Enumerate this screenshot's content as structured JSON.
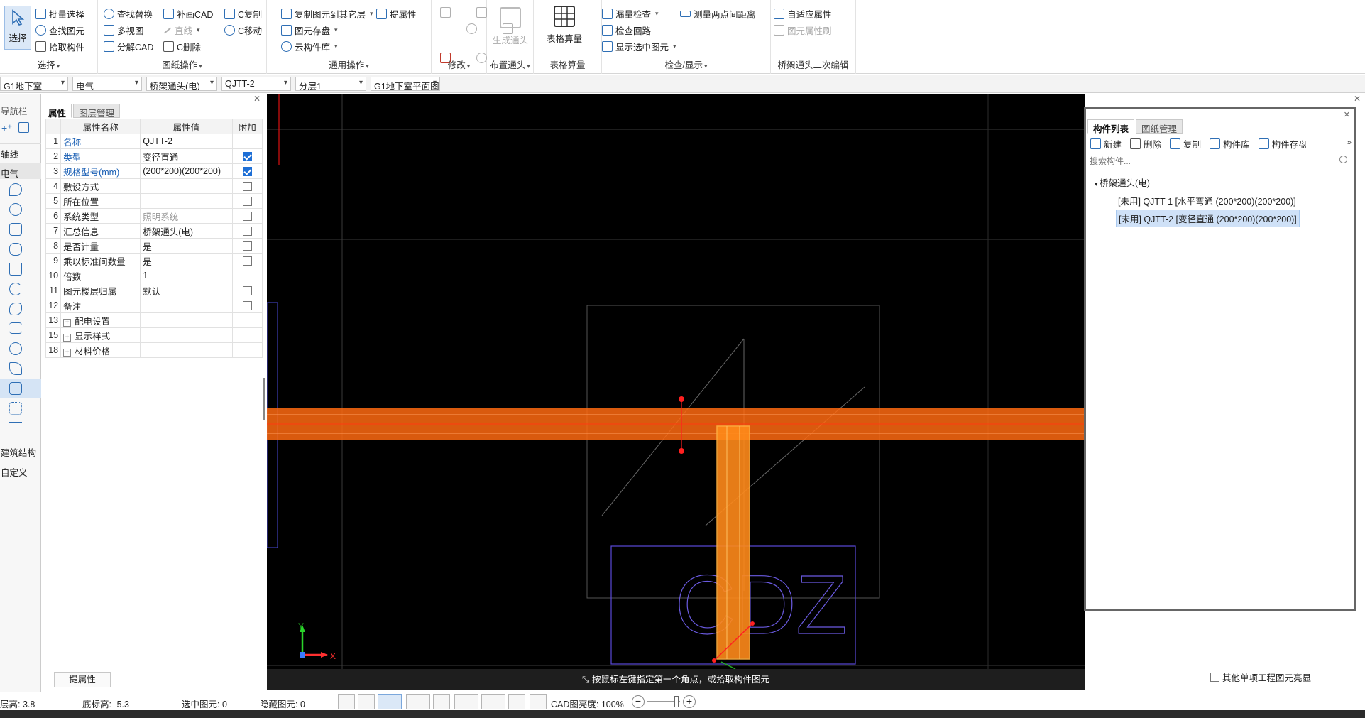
{
  "ribbon": {
    "select_label": "选择",
    "groups": {
      "select": {
        "label": "选择",
        "items": [
          "批量选择",
          "查找图元",
          "拾取构件"
        ]
      },
      "drawing": {
        "label": "图纸操作",
        "items": [
          "查找替换",
          "多视图",
          "分解CAD",
          "补画CAD",
          "直线",
          "C删除",
          "C复制",
          "C移动"
        ]
      },
      "general": {
        "label": "通用操作",
        "items": [
          "复制图元到其它层",
          "图元存盘",
          "云构件库",
          "提属性"
        ]
      },
      "modify": {
        "label": "修改"
      },
      "layout": {
        "label": "布置通头",
        "items": [
          "生成通头"
        ]
      },
      "table": {
        "label": "表格算量",
        "items": [
          "表格算量"
        ]
      },
      "check": {
        "label": "检查/显示",
        "items": [
          "漏量检查",
          "检查回路",
          "显示选中图元",
          "测量两点间距离"
        ]
      },
      "edit": {
        "label": "桥架通头二次编辑",
        "items": [
          "自适应属性",
          "图元属性刷"
        ]
      }
    }
  },
  "selectors": [
    "G1地下室",
    "电气",
    "桥架通头(电)",
    "QJTT-2",
    "分层1",
    "G1地下室平面图"
  ],
  "nav": {
    "title": "导航栏",
    "items": [
      "轴线",
      "电气",
      "建筑结构",
      "自定义"
    ]
  },
  "props": {
    "tabs": [
      "属性",
      "图层管理"
    ],
    "headers": [
      "属性名称",
      "属性值",
      "附加"
    ],
    "rows": [
      {
        "n": "1",
        "name": "名称",
        "value": "QJTT-2",
        "cb": "none"
      },
      {
        "n": "2",
        "name": "类型",
        "value": "变径直通",
        "cb": "on"
      },
      {
        "n": "3",
        "name": "规格型号(mm)",
        "value": "(200*200)(200*200)",
        "cb": "on"
      },
      {
        "n": "4",
        "name": "敷设方式",
        "value": "",
        "cb": "off"
      },
      {
        "n": "5",
        "name": "所在位置",
        "value": "",
        "cb": "off"
      },
      {
        "n": "6",
        "name": "系统类型",
        "value": "照明系统",
        "cb": "off"
      },
      {
        "n": "7",
        "name": "汇总信息",
        "value": "桥架通头(电)",
        "cb": "off"
      },
      {
        "n": "8",
        "name": "是否计量",
        "value": "是",
        "cb": "off"
      },
      {
        "n": "9",
        "name": "乘以标准间数量",
        "value": "是",
        "cb": "off"
      },
      {
        "n": "10",
        "name": "倍数",
        "value": "1",
        "cb": "none"
      },
      {
        "n": "11",
        "name": "图元楼层归属",
        "value": "默认",
        "cb": "off"
      },
      {
        "n": "12",
        "name": "备注",
        "value": "",
        "cb": "off"
      },
      {
        "n": "13",
        "name": "配电设置",
        "value": "",
        "cb": "group"
      },
      {
        "n": "15",
        "name": "显示样式",
        "value": "",
        "cb": "group"
      },
      {
        "n": "18",
        "name": "材料价格",
        "value": "",
        "cb": "group"
      }
    ],
    "bottom_button": "提属性"
  },
  "canvas": {
    "status_text": "按鼠标左键指定第一个角点，或拾取构件图元",
    "axis_x": "X",
    "axis_y": "Y",
    "cad_text": "CDZ"
  },
  "complist": {
    "tabs": [
      "构件列表",
      "图纸管理"
    ],
    "tools": [
      "新建",
      "删除",
      "复制",
      "构件库",
      "构件存盘"
    ],
    "search_placeholder": "搜索构件...",
    "tree_root": "桥架通头(电)",
    "items": [
      "[未用] QJTT-1 [水平弯通 (200*200)(200*200)]",
      "[未用] QJTT-2 [变径直通 (200*200)(200*200)]"
    ]
  },
  "right_strip": {
    "checkbox_label": "其他单项工程图元亮显"
  },
  "statusbar": {
    "floor_height": "层高: 3.8",
    "bottom_elev": "底标高: -5.3",
    "selected": "选中图元: 0",
    "hidden": "隐藏图元: 0",
    "cad_brightness": "CAD图亮度: 100%"
  },
  "colors": {
    "accent": "#2f6fb5",
    "canvas_bg": "#000000",
    "tray": "#ff7a1a",
    "selection": "#cfe1f7"
  }
}
